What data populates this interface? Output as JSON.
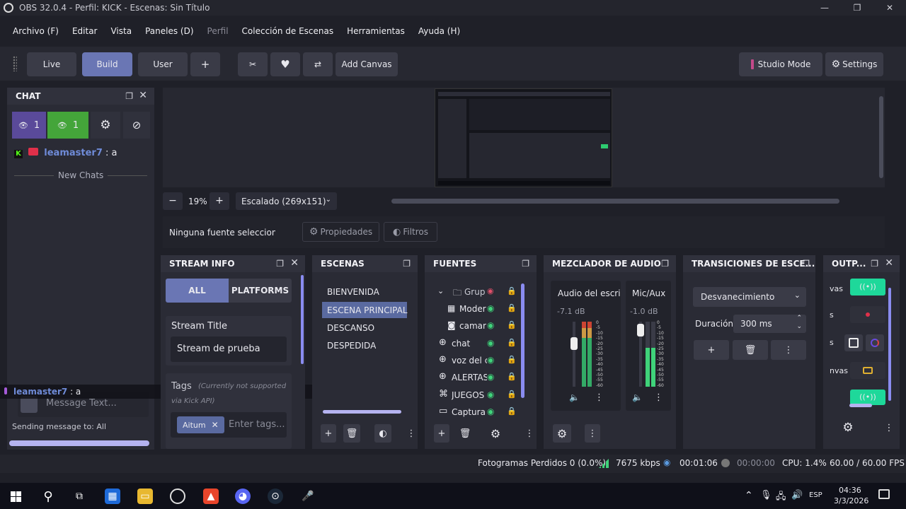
{
  "window": {
    "title": "OBS 32.0.4 - Perfil: KICK - Escenas: Sin Título",
    "controls": [
      "—",
      "❐",
      "✕"
    ]
  },
  "menu": [
    {
      "label": "Archivo (F)",
      "enabled": true
    },
    {
      "label": "Editar",
      "enabled": true
    },
    {
      "label": "Vista",
      "enabled": true
    },
    {
      "label": "Paneles (D)",
      "enabled": true
    },
    {
      "label": "Perfil",
      "enabled": false
    },
    {
      "label": "Colección de Escenas",
      "enabled": true
    },
    {
      "label": "Herramientas",
      "enabled": true
    },
    {
      "label": "Ayuda (H)",
      "enabled": true
    }
  ],
  "toolbar": {
    "live": "Live",
    "build": "Build",
    "user": "User",
    "plus": "+",
    "add_canvas": "Add Canvas",
    "studio_mode": "Studio Mode",
    "settings": "Settings"
  },
  "chat": {
    "title": "CHAT",
    "viewers_a": "1",
    "viewers_b": "1",
    "message": {
      "user": "leamaster7",
      "text": ": a"
    },
    "new_chats": "New Chats",
    "popup": {
      "user": "leamaster7",
      "text": ": a"
    },
    "input_placeholder": "Message Text...",
    "sending_to": "Sending message to: All"
  },
  "preview": {
    "zoom": "19%",
    "scale_option": "Escalado (269x151)",
    "minus": "−",
    "plus": "+"
  },
  "source_bar": {
    "none_selected": "Ninguna fuente seleccionac",
    "properties": "Propiedades",
    "filters": "Filtros"
  },
  "stream_info": {
    "title": "STREAM INFO",
    "tab_all": "ALL",
    "tab_platforms": "PLATFORMS",
    "stream_title_label": "Stream Title",
    "stream_title_value": "Stream de prueba",
    "tags_label": "Tags",
    "tags_note_a": "(Currently not supported",
    "tags_note_b": "via Kick API)",
    "tag": "Aitum",
    "tags_placeholder": "Enter tags..."
  },
  "scenes": {
    "title": "ESCENAS",
    "items": [
      "BIENVENIDA",
      "ESCENA PRINCIPAL",
      "DESCANSO",
      "DESPEDIDA"
    ],
    "selected": 1
  },
  "sources": {
    "title": "FUENTES",
    "items": [
      {
        "name": "Grupo",
        "icon": "folder-icon"
      },
      {
        "name": "Moderr",
        "icon": "film-icon"
      },
      {
        "name": "camara",
        "icon": "camera-icon"
      },
      {
        "name": "chat",
        "icon": "globe-icon"
      },
      {
        "name": "voz del ch",
        "icon": "globe-icon"
      },
      {
        "name": "ALERTAS",
        "icon": "globe-icon"
      },
      {
        "name": "JUEGOS",
        "icon": "gamepad-icon"
      },
      {
        "name": "Captura d",
        "icon": "monitor-icon"
      }
    ]
  },
  "mixer": {
    "title": "MEZCLADOR DE AUDIO",
    "channels": [
      {
        "name": "Audio del escrito",
        "db": "-7.1 dB",
        "level": 0.62
      },
      {
        "name": "Mic/Aux",
        "db": "-1.0 dB",
        "level": 0.8
      }
    ],
    "scale": [
      "0",
      "-5",
      "-10",
      "-15",
      "-20",
      "-25",
      "-30",
      "-35",
      "-40",
      "-45",
      "-50",
      "-55",
      "-60"
    ]
  },
  "transitions": {
    "title": "TRANSICIONES DE ESCE...",
    "selected": "Desvanecimiento",
    "duration_label": "Duración",
    "duration_value": "300 ms"
  },
  "outputs": {
    "title": "OUTP...",
    "rows": [
      "vas",
      "s",
      "s",
      "nvas"
    ]
  },
  "status": {
    "dropped": "Fotogramas Perdidos 0 (0.0%)",
    "kbps": "7675 kbps",
    "rec_time": "00:01:06",
    "stream_time": "00:00:00",
    "cpu": "CPU: 1.4%",
    "fps": "60.00 / 60.00 FPS"
  },
  "taskbar": {
    "lang": "ESP",
    "time": "04:36",
    "date": "3/3/2026"
  },
  "colors": {
    "accent": "#6a76b4",
    "green": "#44a53a",
    "purple": "#5a4a9a",
    "kick": "#53fc18"
  }
}
